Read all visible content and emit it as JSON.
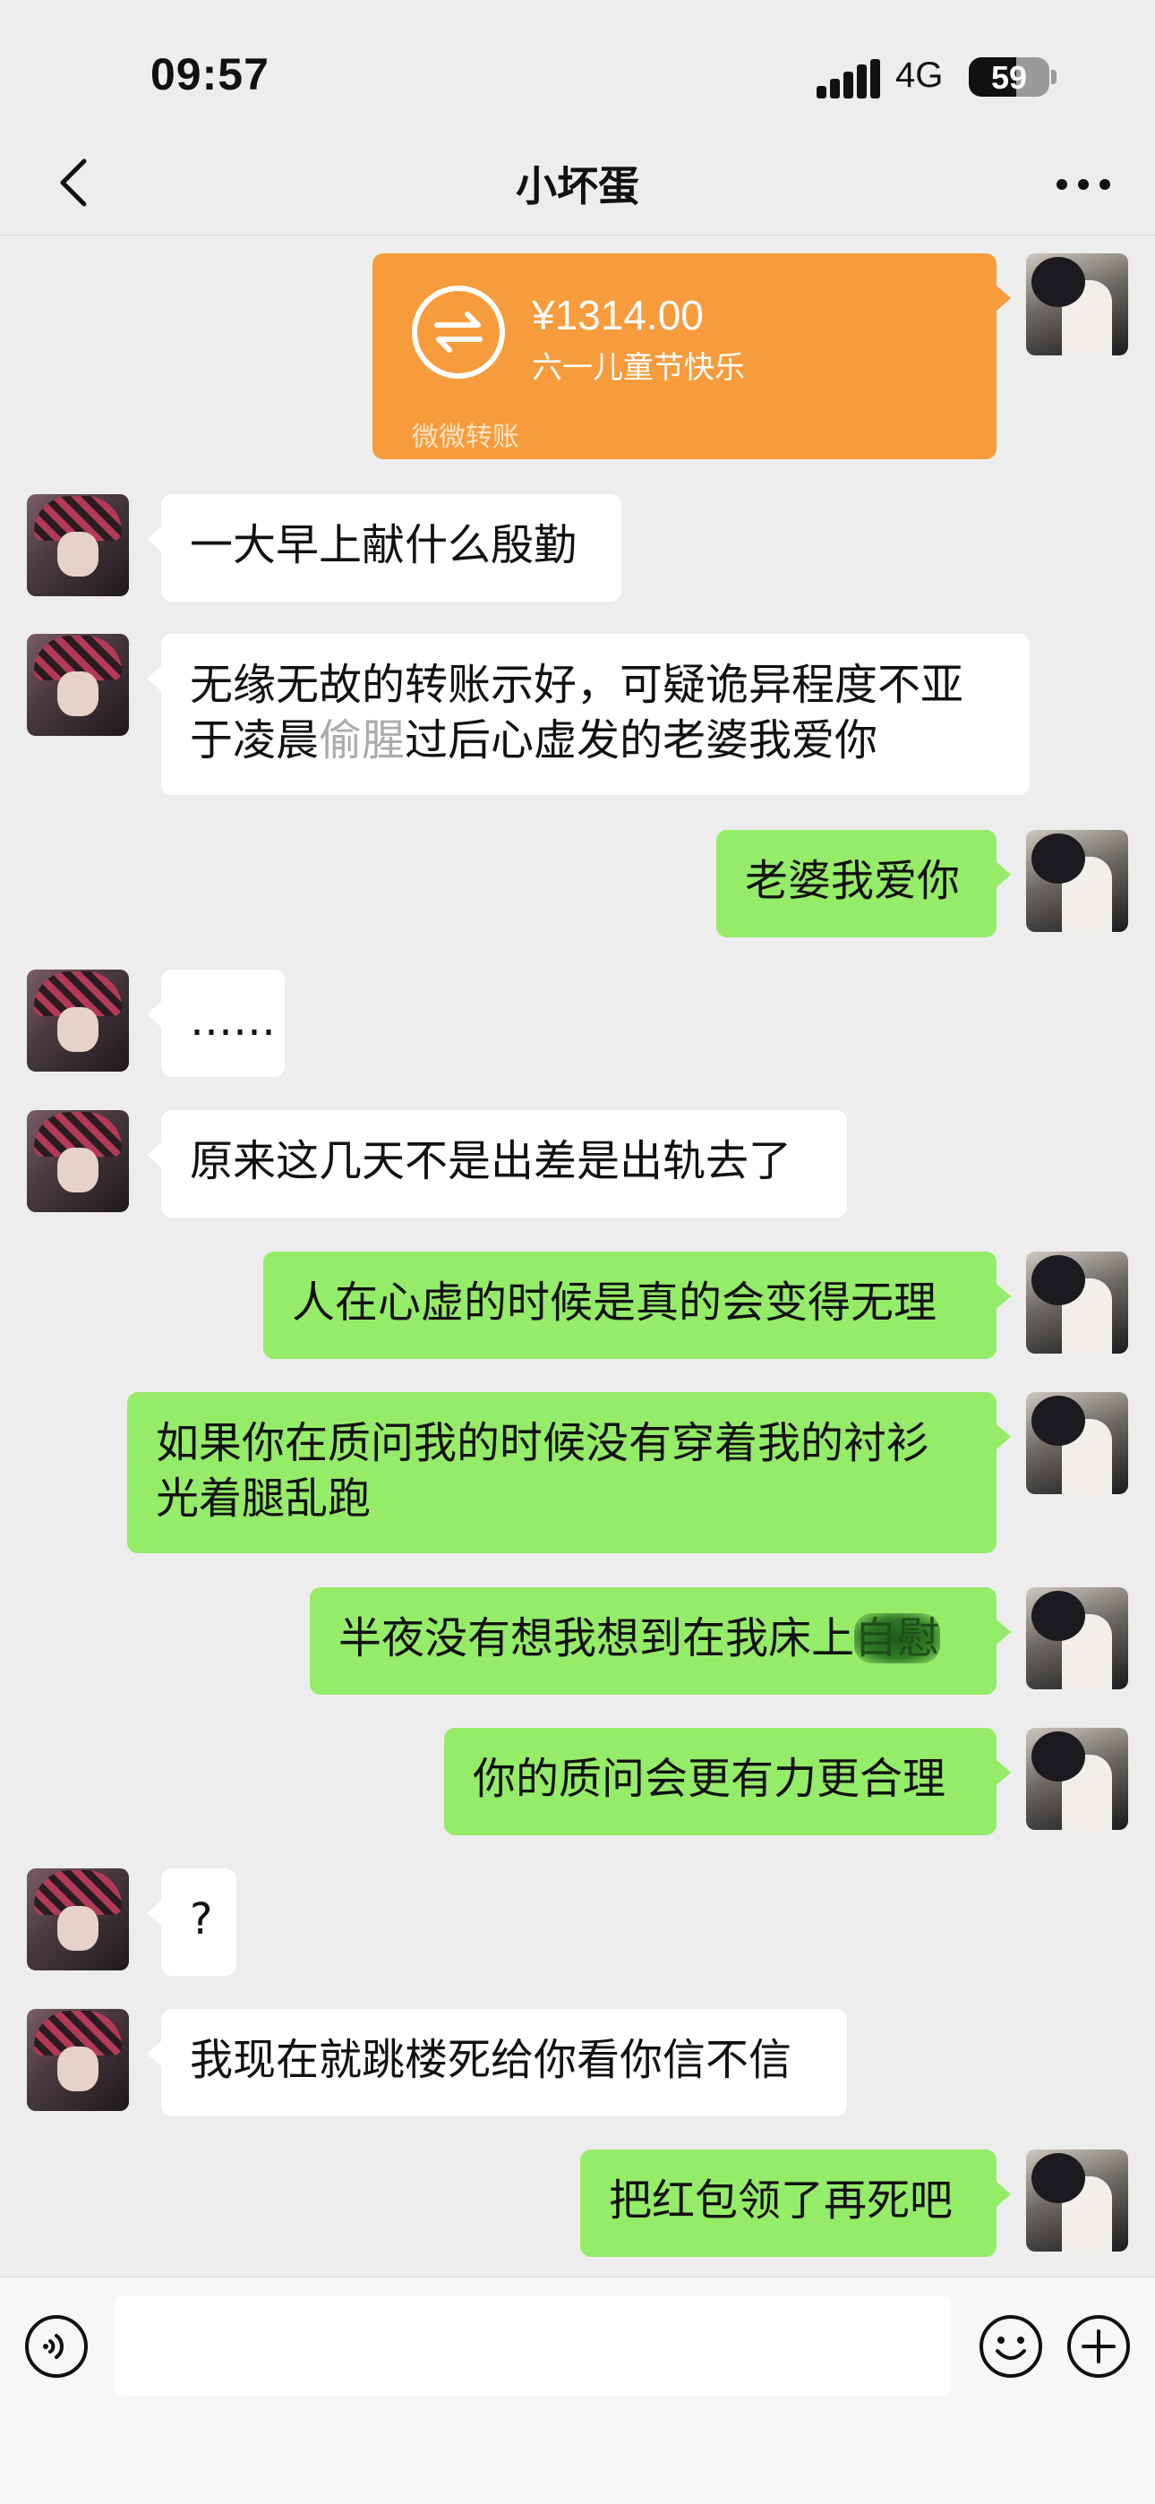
{
  "status_bar": {
    "time": "09:57",
    "network": "4G",
    "battery": "59",
    "battery_level": 0.59
  },
  "nav": {
    "title": "小坏蛋",
    "back_icon": "chevron-left-icon",
    "more_icon": "ellipsis-icon"
  },
  "transfer": {
    "amount": "¥1314.00",
    "note": "六一儿童节快乐",
    "label": "微微转账",
    "color": "#f79c3c"
  },
  "messages": [
    {
      "side": "in",
      "text": "一大早上献什么殷勤"
    },
    {
      "side": "in",
      "line1": "无缘无故的转账示好，可疑诡异程度不亚",
      "line2_a": "于凌晨",
      "line2_b": "偷腥",
      "line2_c": "过后心虚发的老婆我爱你"
    },
    {
      "side": "out",
      "text": "老婆我爱你"
    },
    {
      "side": "in",
      "text": "……"
    },
    {
      "side": "in",
      "text": "原来这几天不是出差是出轨去了"
    },
    {
      "side": "out",
      "text": "人在心虚的时候是真的会变得无理"
    },
    {
      "side": "out",
      "line1": "如果你在质问我的时候没有穿着我的衬衫",
      "line2": "光着腿乱跑"
    },
    {
      "side": "out",
      "text_a": "半夜没有想我想到在我床上",
      "text_b": "自慰"
    },
    {
      "side": "out",
      "text": "你的质问会更有力更合理"
    },
    {
      "side": "in",
      "text": "?"
    },
    {
      "side": "in",
      "text": "我现在就跳楼死给你看你信不信"
    },
    {
      "side": "out",
      "text": "把红包领了再死吧"
    }
  ],
  "input_bar": {
    "voice_icon": "voice-icon",
    "emoji_icon": "emoji-icon",
    "plus_icon": "plus-icon",
    "value": ""
  },
  "colors": {
    "background": "#ededed",
    "outgoing_bubble": "#95ec69",
    "incoming_bubble": "#ffffff"
  }
}
